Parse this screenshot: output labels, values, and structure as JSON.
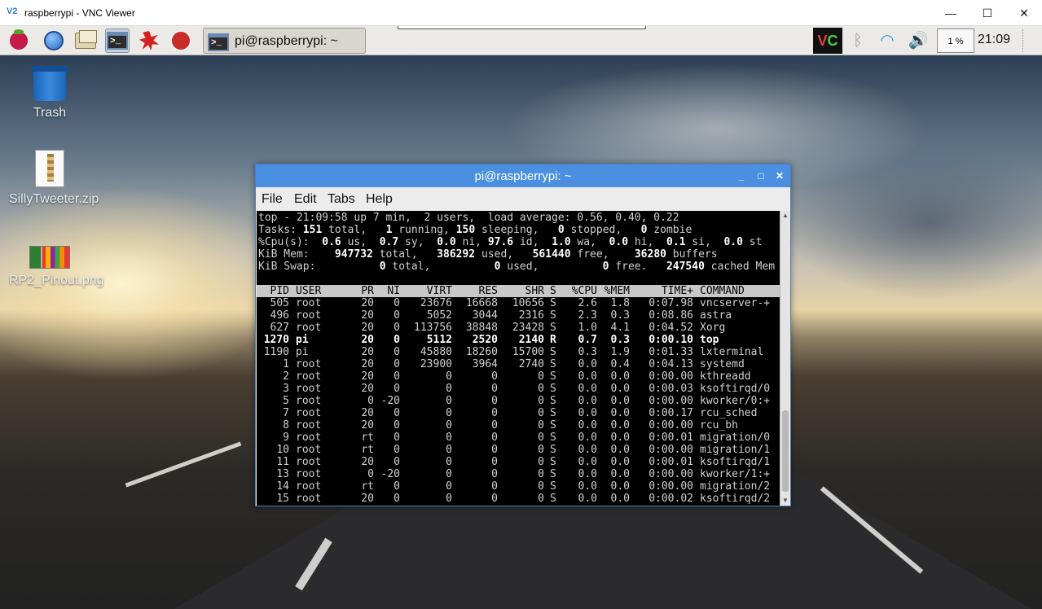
{
  "host": {
    "title": "raspberrypi - VNC Viewer",
    "logo": "V2",
    "controls": {
      "minimize": "—",
      "maximize": "☐",
      "close": "✕"
    }
  },
  "panel": {
    "launchers": [
      "raspberry-menu-icon",
      "browser-globe-icon",
      "file-manager-icon",
      "terminal-icon",
      "math-burst-icon",
      "wolfram-icon"
    ],
    "taskbar_item": "pi@raspberrypi: ~",
    "tray": {
      "vnc": "V",
      "vnc_c": "C",
      "cpu": "1 %",
      "clock": "21:09"
    }
  },
  "desktop_icons": [
    {
      "label": "Trash"
    },
    {
      "label": "SillyTweeter.zip"
    },
    {
      "label": "RP2_Pinout.png"
    }
  ],
  "terminal": {
    "title": "pi@raspberrypi: ~",
    "menu": [
      "File",
      "Edit",
      "Tabs",
      "Help"
    ],
    "top_summary": {
      "line1": "top - 21:09:58 up 7 min,  2 users,  load average: 0.56, 0.40, 0.22",
      "tasks": {
        "total": "151",
        "running": "1",
        "sleeping": "150",
        "stopped": "0",
        "zombie": "0"
      },
      "cpu": {
        "us": "0.6",
        "sy": "0.7",
        "ni": "0.0",
        "id": "97.6",
        "wa": "1.0",
        "hi": "0.0",
        "si": "0.1",
        "st": "0.0"
      },
      "mem": {
        "total": "947732",
        "used": "386292",
        "free": "561440",
        "buffers": "36280"
      },
      "swap": {
        "total": "0",
        "used": "0",
        "free": "0",
        "cached": "247540"
      }
    },
    "columns": [
      "PID",
      "USER",
      "PR",
      "NI",
      "VIRT",
      "RES",
      "SHR",
      "S",
      "%CPU",
      "%MEM",
      "TIME+",
      "COMMAND"
    ],
    "processes": [
      [
        "505",
        "root",
        "20",
        "0",
        "23676",
        "16668",
        "10656",
        "S",
        "2.6",
        "1.8",
        "0:07.98",
        "vncserver-+"
      ],
      [
        "496",
        "root",
        "20",
        "0",
        "5052",
        "3044",
        "2316",
        "S",
        "2.3",
        "0.3",
        "0:08.86",
        "astra"
      ],
      [
        "627",
        "root",
        "20",
        "0",
        "113756",
        "38848",
        "23428",
        "S",
        "1.0",
        "4.1",
        "0:04.52",
        "Xorg"
      ],
      [
        "1270",
        "pi",
        "20",
        "0",
        "5112",
        "2520",
        "2140",
        "R",
        "0.7",
        "0.3",
        "0:00.10",
        "top"
      ],
      [
        "1190",
        "pi",
        "20",
        "0",
        "45880",
        "18260",
        "15700",
        "S",
        "0.3",
        "1.9",
        "0:01.33",
        "lxterminal"
      ],
      [
        "1",
        "root",
        "20",
        "0",
        "23900",
        "3964",
        "2740",
        "S",
        "0.0",
        "0.4",
        "0:04.13",
        "systemd"
      ],
      [
        "2",
        "root",
        "20",
        "0",
        "0",
        "0",
        "0",
        "S",
        "0.0",
        "0.0",
        "0:00.00",
        "kthreadd"
      ],
      [
        "3",
        "root",
        "20",
        "0",
        "0",
        "0",
        "0",
        "S",
        "0.0",
        "0.0",
        "0:00.03",
        "ksoftirqd/0"
      ],
      [
        "5",
        "root",
        "0",
        "-20",
        "0",
        "0",
        "0",
        "S",
        "0.0",
        "0.0",
        "0:00.00",
        "kworker/0:+"
      ],
      [
        "7",
        "root",
        "20",
        "0",
        "0",
        "0",
        "0",
        "S",
        "0.0",
        "0.0",
        "0:00.17",
        "rcu_sched"
      ],
      [
        "8",
        "root",
        "20",
        "0",
        "0",
        "0",
        "0",
        "S",
        "0.0",
        "0.0",
        "0:00.00",
        "rcu_bh"
      ],
      [
        "9",
        "root",
        "rt",
        "0",
        "0",
        "0",
        "0",
        "S",
        "0.0",
        "0.0",
        "0:00.01",
        "migration/0"
      ],
      [
        "10",
        "root",
        "rt",
        "0",
        "0",
        "0",
        "0",
        "S",
        "0.0",
        "0.0",
        "0:00.00",
        "migration/1"
      ],
      [
        "11",
        "root",
        "20",
        "0",
        "0",
        "0",
        "0",
        "S",
        "0.0",
        "0.0",
        "0:00.01",
        "ksoftirqd/1"
      ],
      [
        "13",
        "root",
        "0",
        "-20",
        "0",
        "0",
        "0",
        "S",
        "0.0",
        "0.0",
        "0:00.00",
        "kworker/1:+"
      ],
      [
        "14",
        "root",
        "rt",
        "0",
        "0",
        "0",
        "0",
        "S",
        "0.0",
        "0.0",
        "0:00.00",
        "migration/2"
      ],
      [
        "15",
        "root",
        "20",
        "0",
        "0",
        "0",
        "0",
        "S",
        "0.0",
        "0.0",
        "0:00.02",
        "ksoftirqd/2"
      ]
    ],
    "highlight_pid": "1270"
  }
}
